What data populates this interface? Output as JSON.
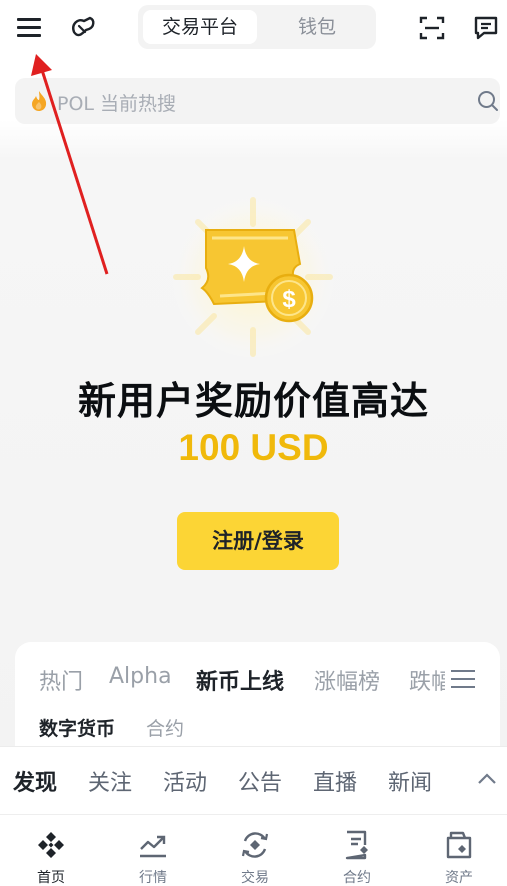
{
  "header": {
    "segments": [
      {
        "label": "交易平台",
        "active": true
      },
      {
        "label": "钱包",
        "active": false
      }
    ]
  },
  "search": {
    "placeholder": "POL 当前热搜"
  },
  "promo": {
    "title": "新用户奖励价值高达",
    "amount": "100 USD",
    "button_label": "注册/登录"
  },
  "market": {
    "tabs": [
      "热门",
      "Alpha",
      "新币上线",
      "涨幅榜",
      "跌幅榜"
    ],
    "active_tab": "新币上线",
    "sub_tabs": [
      "数字货币",
      "合约"
    ],
    "active_sub_tab": "数字货币"
  },
  "discover": {
    "tabs": [
      "发现",
      "关注",
      "活动",
      "公告",
      "直播",
      "新闻"
    ],
    "active_tab": "发现"
  },
  "bottom_nav": [
    {
      "label": "首页",
      "icon": "home-icon",
      "active": true
    },
    {
      "label": "行情",
      "icon": "markets-icon",
      "active": false
    },
    {
      "label": "交易",
      "icon": "trade-icon",
      "active": false
    },
    {
      "label": "合约",
      "icon": "futures-icon",
      "active": false
    },
    {
      "label": "资产",
      "icon": "wallet-icon",
      "active": false
    }
  ],
  "colors": {
    "accent": "#fcd535",
    "gold": "#f0b90b",
    "text_primary": "#1e2329",
    "text_secondary": "#707a8a",
    "annotation_arrow": "#e02020"
  }
}
